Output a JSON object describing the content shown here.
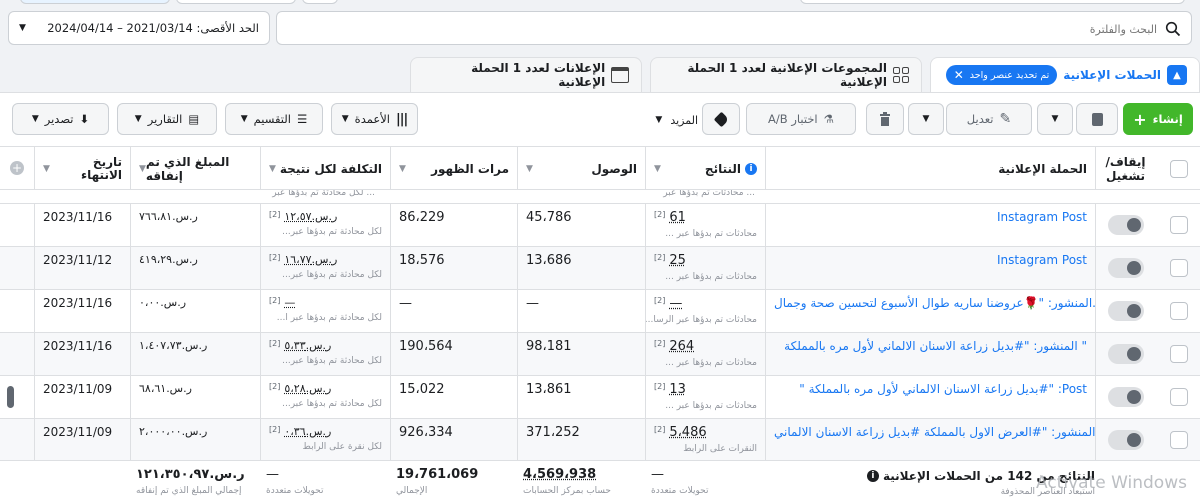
{
  "search": {
    "placeholder": "البحث والفلترة"
  },
  "date_range": {
    "label": "الحد الأقصى: 2021/03/14 – 2024/04/14"
  },
  "tabs": [
    {
      "label": "الحملات الإعلانية",
      "selection_badge": "تم تحديد عنصر واحد"
    },
    {
      "label": "المجموعات الإعلانية لعدد 1 الحملة الإعلانية"
    },
    {
      "label": "الإعلانات لعدد 1 الحملة الإعلانية"
    }
  ],
  "toolbar": {
    "create": "إنشاء",
    "edit": "تعديل",
    "ab_test": "اختبار A/B",
    "more": "المزيد",
    "columns": "الأعمدة",
    "breakdown": "التقسيم",
    "reports": "التقارير",
    "export": "تصدير"
  },
  "columns": {
    "toggle": "إيقاف/ تشغيل",
    "campaign": "الحملة الإعلانية",
    "results": "النتائج",
    "reach": "الوصول",
    "impressions": "مرات الظهور",
    "cost_per_result": "التكلفة لكل نتيجة",
    "amount_spent": "المبلغ الذي تم إنفاقه",
    "end_date": "تاريخ الانتهاء"
  },
  "partial_row": {
    "cost_sub": "لكل محادثة تم بدؤها عبر ...",
    "results_sub": "محادثات تم بدؤها عبر ..."
  },
  "rows": [
    {
      "campaign": "Instagram Post",
      "results": "61",
      "results_sub": "محادثات تم بدؤها عبر ...",
      "reach": "45،786",
      "impressions": "86،229",
      "cost": "ر.س.١٢،٥٧",
      "cost_sub": "لكل محادثة تم بدؤها عبر...",
      "spent": "ر.س.٧٦٦،٨١",
      "end": "2023/11/16"
    },
    {
      "campaign": "Instagram Post",
      "results": "25",
      "results_sub": "محادثات تم بدؤها عبر ...",
      "reach": "13،686",
      "impressions": "18،576",
      "cost": "ر.س.١٦،٧٧",
      "cost_sub": "لكل محادثة تم بدؤها عبر...",
      "spent": "ر.س.٤١٩،٢٩",
      "end": "2023/11/12"
    },
    {
      "campaign": "المنشور: \"🌹عروضنا ساريه طوال الأسبوع لتحسين صحة وجمال...",
      "results": "—",
      "results_sub": "محادثات تم بدؤها عبر الرسا...",
      "reach": "—",
      "impressions": "—",
      "cost": "—",
      "cost_sub": "لكل محادثة تم بدؤها عبر ا...",
      "spent": "ر.س.٠،٠٠",
      "end": "2023/11/16"
    },
    {
      "campaign": "المنشور: \"#بديل زراعة الاسنان الالماني لأول مره بالمملكة \"",
      "results": "264",
      "results_sub": "محادثات تم بدؤها عبر ...",
      "reach": "98،181",
      "impressions": "190،564",
      "cost": "ر.س.٥،٣٣",
      "cost_sub": "لكل محادثة تم بدؤها عبر...",
      "spent": "ر.س.١،٤٠٧،٧٣",
      "end": "2023/11/16"
    },
    {
      "campaign": "\" بديل زراعة الاسنان الالماني لأول مره بالمملكة#\" :Post",
      "results": "13",
      "results_sub": "محادثات تم بدؤها عبر ...",
      "reach": "13،861",
      "impressions": "15،022",
      "cost": "ر.س.٥،٢٨",
      "cost_sub": "لكل محادثة تم بدؤها عبر...",
      "spent": "ر.س.٦٨،٦١",
      "end": "2023/11/09"
    },
    {
      "campaign": "المنشور: \"#العرض الاول بالمملكة #بديل زراعة الاسنان الالماني \"",
      "results": "5،486",
      "results_sub": "النقرات على الرابط",
      "reach": "371،252",
      "impressions": "926،334",
      "cost": "ر.س.٠،٣٦",
      "cost_sub": "لكل نقرة على الرابط",
      "spent": "ر.س.٢،٠٠٠،٠٠",
      "end": "2023/11/09"
    }
  ],
  "footer": {
    "title": "النتائج من 142 من الحملات الإعلانية",
    "sub": "استبعاد العناصر المحذوفة",
    "results": "—",
    "results_sub": "تحويلات متعددة",
    "reach": "4،569،938",
    "reach_sub": "حساب بمركز الحسابات",
    "impressions": "19،761،069",
    "impressions_sub": "الإجمالي",
    "cost": "—",
    "cost_sub": "تحويلات متعددة",
    "spent": "ر.س.١٢١،٣٥٠،٩٧",
    "spent_sub": "إجمالي المبلغ الذي تم إنفاقه"
  },
  "watermark": "Activate Windows"
}
